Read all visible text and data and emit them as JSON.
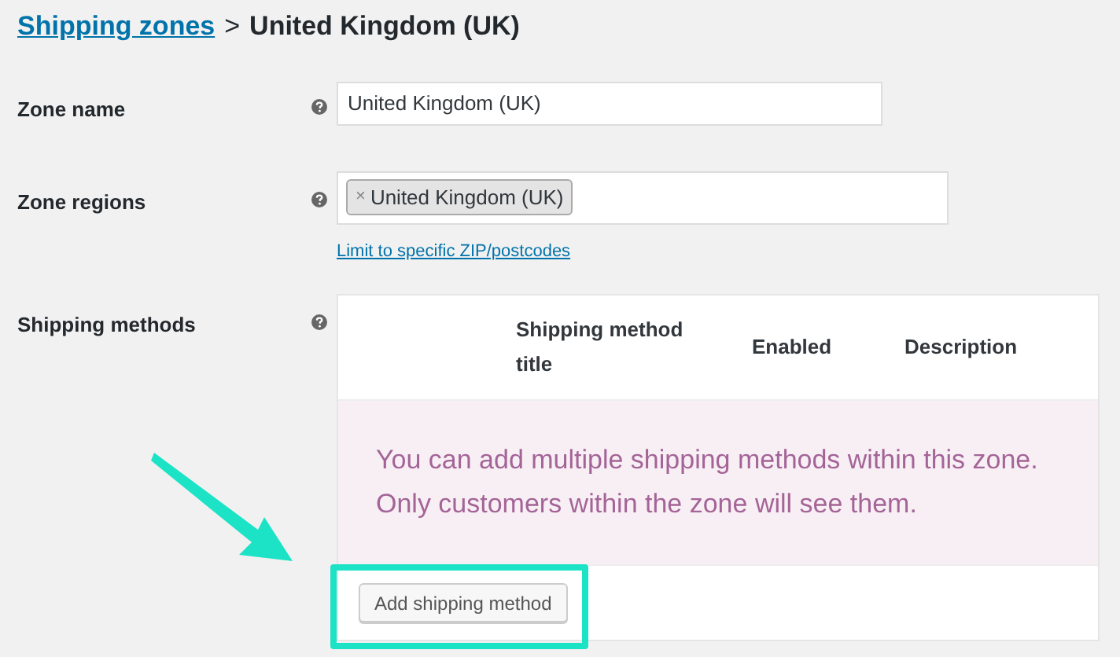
{
  "breadcrumb": {
    "link": "Shipping zones",
    "separator": ">",
    "current": "United Kingdom (UK)"
  },
  "zone_name": {
    "label": "Zone name",
    "value": "United Kingdom (UK)"
  },
  "zone_regions": {
    "label": "Zone regions",
    "tags": [
      "United Kingdom (UK)"
    ],
    "tag_remove": "×",
    "link": "Limit to specific ZIP/postcodes"
  },
  "shipping_methods": {
    "label": "Shipping methods",
    "columns": [
      "Shipping method title",
      "Enabled",
      "Description"
    ],
    "empty_message": "You can add multiple shipping methods within this zone. Only customers within the zone will see them.",
    "button": "Add shipping method",
    "highlighted": true
  }
}
